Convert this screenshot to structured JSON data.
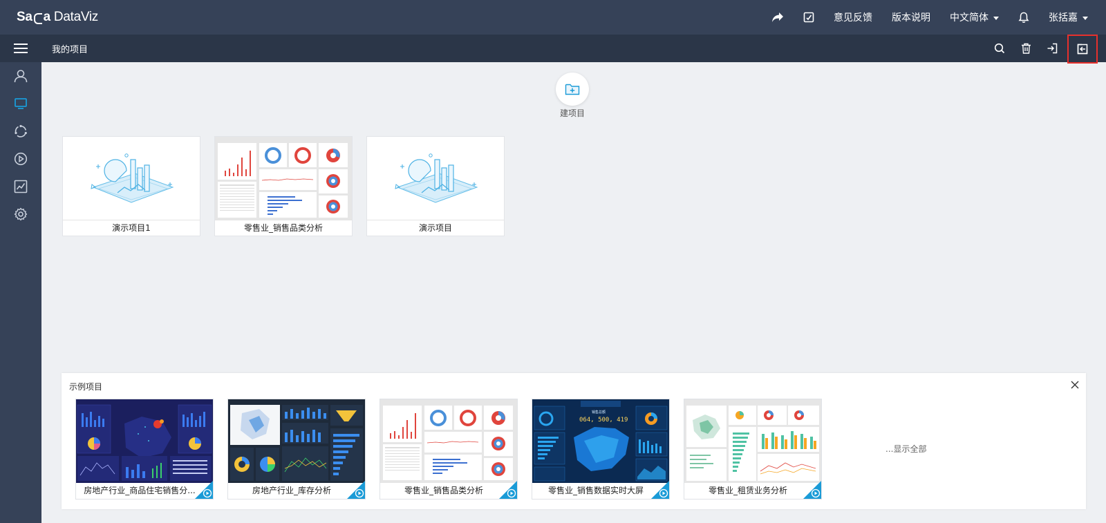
{
  "app": {
    "logo_a": "Sa",
    "logo_b": "a",
    "logo_c": "DataViz"
  },
  "topbar": {
    "feedback": "意见反馈",
    "release_notes": "版本说明",
    "language": "中文简体",
    "user": "张括嘉"
  },
  "subbar": {
    "breadcrumb": "我的项目"
  },
  "new_project": {
    "label": "建项目"
  },
  "projects": [
    {
      "name": "演示项目1"
    },
    {
      "name": "零售业_销售品类分析"
    },
    {
      "name": "演示项目"
    }
  ],
  "samples": {
    "title": "示例项目",
    "show_all": "...显示全部",
    "items": [
      {
        "name": "房地产行业_商品住宅销售分..."
      },
      {
        "name": "房地产行业_库存分析"
      },
      {
        "name": "零售业_销售品类分析"
      },
      {
        "name": "零售业_销售数据实时大屏"
      },
      {
        "name": "零售业_租赁业务分析"
      }
    ]
  },
  "thumb_text": {
    "sales_total_label": "销售总额",
    "sales_total_value": "064, 500, 419"
  },
  "colors": {
    "accent": "#1a9bd7",
    "topbar": "#364258",
    "subbar": "#2b3648",
    "highlight": "#e8302c"
  }
}
